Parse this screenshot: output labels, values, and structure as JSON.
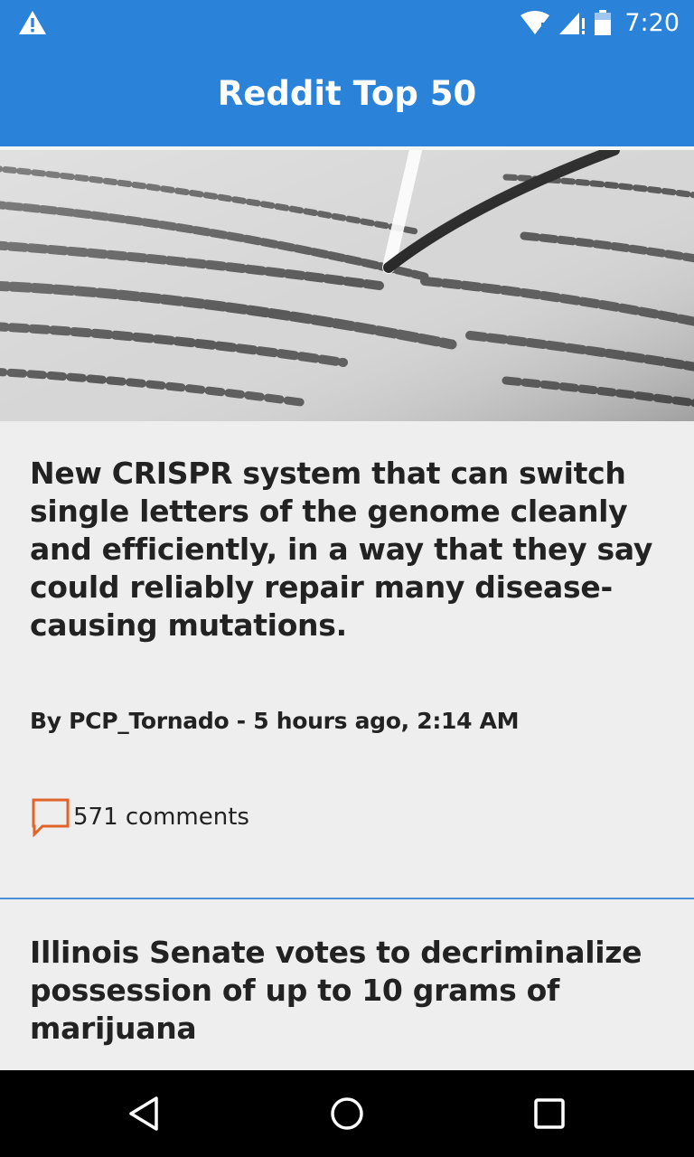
{
  "status_bar": {
    "time": "7:20",
    "icons": [
      "warning-icon",
      "wifi-icon",
      "signal-icon",
      "battery-icon"
    ]
  },
  "app_bar": {
    "title": "Reddit Top 50"
  },
  "colors": {
    "primary": "#2a82d9",
    "comment_icon": "#e0632a",
    "background": "#eeeeee",
    "text": "#222222"
  },
  "posts": [
    {
      "image": "dna-sequence-photo",
      "title": "New CRISPR system that can switch single letters of the genome cleanly and efficiently, in a way that they say could reliably repair many disease-causing mutations.",
      "byline": "By PCP_Tornado - 5 hours ago, 2:14 AM",
      "comments": "571 comments"
    },
    {
      "title": "Illinois Senate votes to decriminalize possession of up to 10 grams of marijuana"
    }
  ],
  "nav_bar": {
    "icons": [
      "back-icon",
      "home-icon",
      "recents-icon"
    ]
  }
}
